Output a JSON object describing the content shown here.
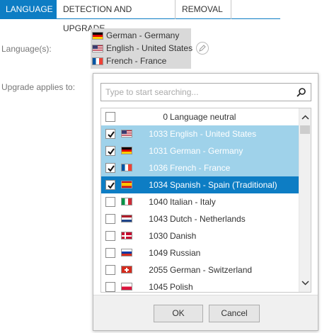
{
  "tabs": [
    {
      "label": "LANGUAGE",
      "active": true
    },
    {
      "label": "DETECTION AND UPGRADE",
      "active": false
    },
    {
      "label": "REMOVAL",
      "active": false
    }
  ],
  "form": {
    "languages_label": "Language(s):",
    "upgrade_label": "Upgrade applies to:",
    "selected": [
      {
        "flag": "germany-flag",
        "text": "German - Germany"
      },
      {
        "flag": "usa-flag",
        "text": "English - United States"
      },
      {
        "flag": "france-flag",
        "text": "French - France"
      }
    ]
  },
  "dropdown": {
    "search_placeholder": "Type to start searching...",
    "search_value": "",
    "items": [
      {
        "lcid": "0",
        "name": "Language neutral",
        "flag": "none",
        "checked": false,
        "state": "normal"
      },
      {
        "lcid": "1033",
        "name": "English - United States",
        "flag": "usa-flag",
        "checked": true,
        "state": "selected"
      },
      {
        "lcid": "1031",
        "name": "German - Germany",
        "flag": "germany-flag",
        "checked": true,
        "state": "selected"
      },
      {
        "lcid": "1036",
        "name": "French - France",
        "flag": "france-flag",
        "checked": true,
        "state": "selected"
      },
      {
        "lcid": "1034",
        "name": "Spanish - Spain (Traditional)",
        "flag": "spain-flag",
        "checked": true,
        "state": "active"
      },
      {
        "lcid": "1040",
        "name": "Italian - Italy",
        "flag": "italy-flag",
        "checked": false,
        "state": "normal"
      },
      {
        "lcid": "1043",
        "name": "Dutch - Netherlands",
        "flag": "netherlands-flag",
        "checked": false,
        "state": "normal"
      },
      {
        "lcid": "1030",
        "name": "Danish",
        "flag": "denmark-flag",
        "checked": false,
        "state": "normal"
      },
      {
        "lcid": "1049",
        "name": "Russian",
        "flag": "russia-flag",
        "checked": false,
        "state": "normal"
      },
      {
        "lcid": "2055",
        "name": "German - Switzerland",
        "flag": "switzerland-flag",
        "checked": false,
        "state": "normal"
      },
      {
        "lcid": "1045",
        "name": "Polish",
        "flag": "poland-flag",
        "checked": false,
        "state": "normal"
      }
    ],
    "ok_label": "OK",
    "cancel_label": "Cancel"
  },
  "colors": {
    "accent": "#0d7dc4",
    "selected_row": "#9fd2ea",
    "selected_chips_bg": "#d9d9d9"
  }
}
